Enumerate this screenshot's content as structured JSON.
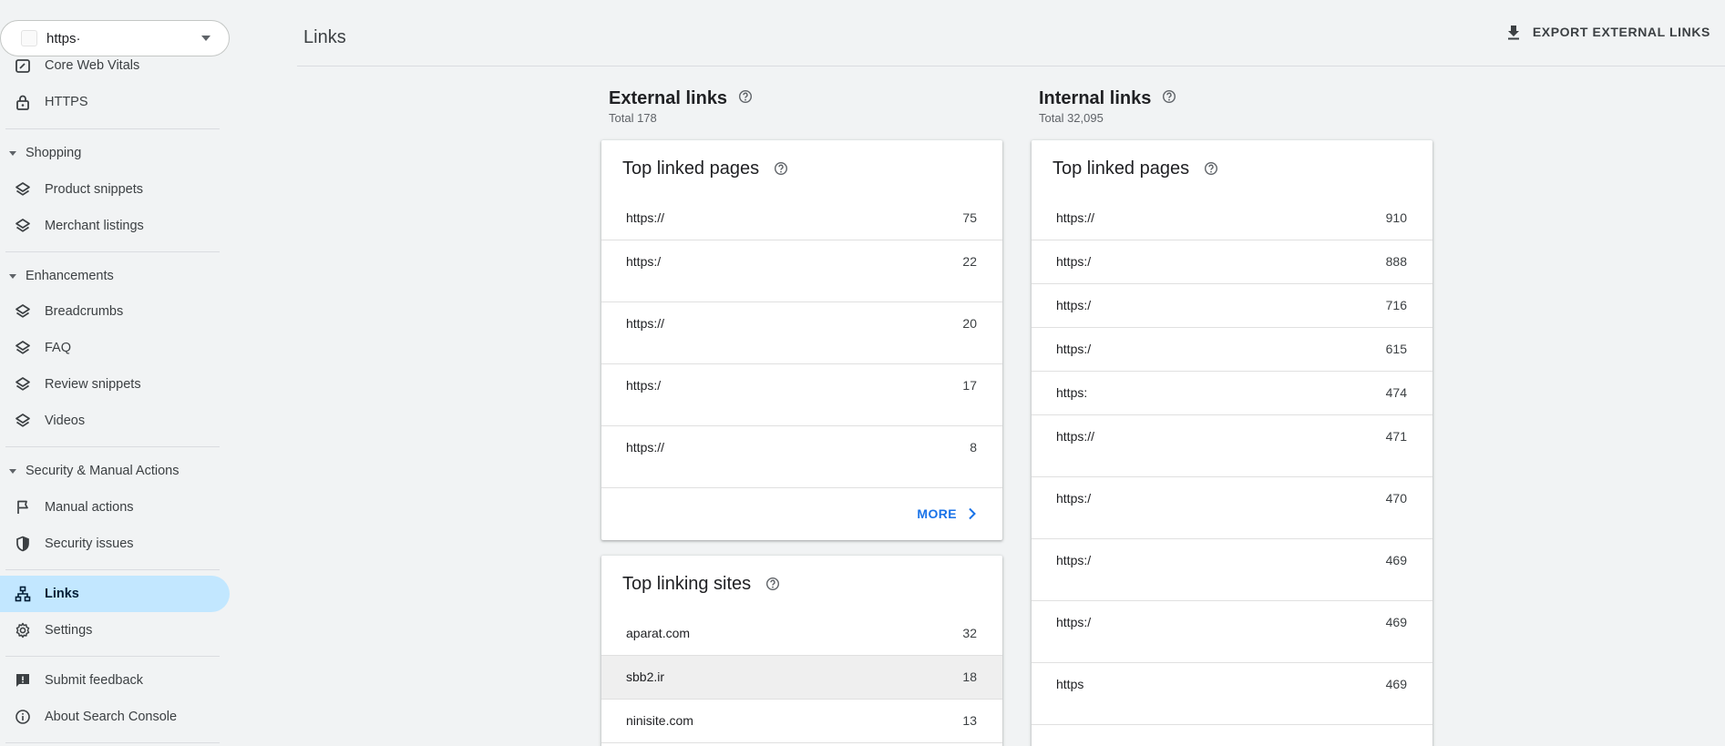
{
  "property": {
    "value": "https·"
  },
  "sidebar": {
    "top_items": [
      {
        "label": "Core Web Vitals",
        "icon": "speed-icon"
      },
      {
        "label": "HTTPS",
        "icon": "lock-icon"
      }
    ],
    "sections": [
      {
        "title": "Shopping",
        "items": [
          {
            "label": "Product snippets",
            "icon": "layers-icon"
          },
          {
            "label": "Merchant listings",
            "icon": "layers-icon"
          }
        ]
      },
      {
        "title": "Enhancements",
        "items": [
          {
            "label": "Breadcrumbs",
            "icon": "layers-icon"
          },
          {
            "label": "FAQ",
            "icon": "layers-icon"
          },
          {
            "label": "Review snippets",
            "icon": "layers-icon"
          },
          {
            "label": "Videos",
            "icon": "layers-icon"
          }
        ]
      },
      {
        "title": "Security & Manual Actions",
        "items": [
          {
            "label": "Manual actions",
            "icon": "flag-icon"
          },
          {
            "label": "Security issues",
            "icon": "shield-icon"
          }
        ]
      }
    ],
    "links": {
      "label": "Links",
      "icon": "sitemap-icon"
    },
    "settings": {
      "label": "Settings",
      "icon": "gear-icon"
    },
    "footer": [
      {
        "label": "Submit feedback",
        "icon": "feedback-icon"
      },
      {
        "label": "About Search Console",
        "icon": "info-icon"
      }
    ]
  },
  "header": {
    "title": "Links",
    "export_label": "EXPORT EXTERNAL LINKS"
  },
  "external": {
    "title": "External links",
    "total": "Total 178",
    "top_linked_pages": {
      "title": "Top linked pages",
      "rows": [
        {
          "url": "https://",
          "count": "75"
        },
        {
          "url": "https:/",
          "count": "22"
        },
        {
          "url": "https://",
          "count": "20"
        },
        {
          "url": "https:/",
          "count": "17"
        },
        {
          "url": "https://",
          "count": "8"
        }
      ],
      "more_label": "MORE"
    },
    "top_linking_sites": {
      "title": "Top linking sites",
      "rows": [
        {
          "site": "aparat.com",
          "count": "32"
        },
        {
          "site": "sbb2.ir",
          "count": "18"
        },
        {
          "site": "ninisite.com",
          "count": "13"
        }
      ]
    }
  },
  "internal": {
    "title": "Internal links",
    "total": "Total 32,095",
    "top_linked_pages": {
      "title": "Top linked pages",
      "rows": [
        {
          "url": "https://",
          "count": "910"
        },
        {
          "url": "https:/",
          "count": "888"
        },
        {
          "url": "https:/",
          "count": "716"
        },
        {
          "url": "https:/",
          "count": "615"
        },
        {
          "url": "https:",
          "count": "474"
        },
        {
          "url": "https://",
          "count": "471"
        },
        {
          "url": "https:/",
          "count": "470"
        },
        {
          "url": "https:/",
          "count": "469"
        },
        {
          "url": "https:/",
          "count": "469"
        },
        {
          "url": "https",
          "count": "469"
        }
      ]
    }
  }
}
